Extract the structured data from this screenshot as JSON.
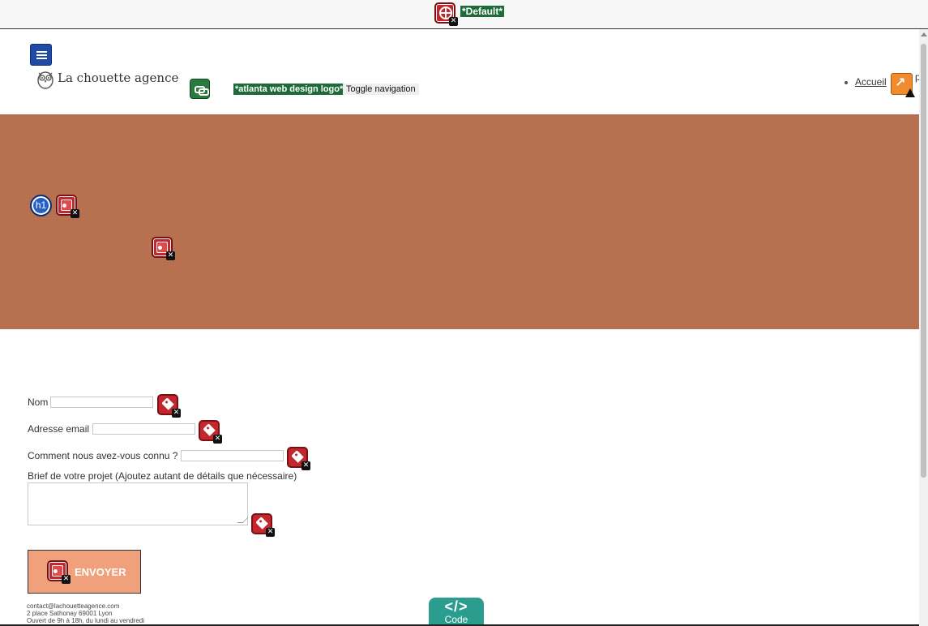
{
  "toolbar": {
    "default_label": "*Default*",
    "icons": [
      "language-error-icon"
    ]
  },
  "header": {
    "logo_brand": "La chouette agence",
    "logo_alt_label": "*atlanta web design logo*",
    "toggle_nav_label": "Toggle navigation",
    "nav_items": [
      {
        "label": "Accueil"
      }
    ],
    "truncated_text": "p"
  },
  "banner": {
    "heading_badge": "h1",
    "background_color": "#b87150"
  },
  "form": {
    "name_label": "Nom",
    "name_value": "",
    "email_label": "Adresse email",
    "email_value": "",
    "source_label": "Comment nous avez-vous connu ?",
    "source_value": "",
    "brief_label": "Brief de votre projet (Ajoutez autant de détails que nécessaire)",
    "brief_value": "",
    "submit_label": "ENVOYER"
  },
  "footer": {
    "email": "contact@lachouetteagence.com",
    "address": "2 place Sathonay 69001 Lyon",
    "hours": "Ouvert de 9h à 18h, du lundi au vendredi"
  },
  "code_tab": {
    "symbol": "</>",
    "label": "Code"
  },
  "colors": {
    "error_red": "#c1272d",
    "alert_green": "#1e6b3a",
    "structure_blue": "#1f4aa8",
    "warning_orange": "#f08c2e",
    "code_teal": "#2a9d8f",
    "button_salmon": "#f0a17c"
  }
}
